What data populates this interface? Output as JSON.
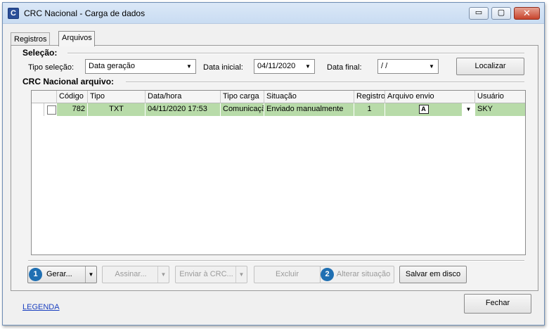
{
  "window": {
    "app_icon": "C",
    "title": "CRC Nacional - Carga de dados",
    "minimize": "▭",
    "maximize": "▢",
    "close": "✕"
  },
  "tabs": [
    {
      "label": "Registros"
    },
    {
      "label": "Arquivos"
    }
  ],
  "selection": {
    "title": "Seleção:",
    "tipo_label": "Tipo seleção:",
    "tipo_value": "Data geração",
    "data_inicial_label": "Data inicial:",
    "data_inicial_value": "04/11/2020",
    "data_final_label": "Data final:",
    "data_final_value": " /  /",
    "localizar": "Localizar"
  },
  "grid": {
    "title": "CRC Nacional arquivo:",
    "columns": [
      "Código",
      "Tipo",
      "Data/hora",
      "Tipo carga",
      "Situação",
      "Registro",
      "Arquivo envio",
      "Usuário"
    ],
    "rows": [
      {
        "codigo": "782",
        "tipo": "TXT",
        "data_hora": "04/11/2020 17:53",
        "tipo_carga": "Comunicação",
        "situacao": "Enviado manualmente",
        "registros": "1",
        "arquivo_icon": "A",
        "usuario": "SKY"
      }
    ]
  },
  "actions": {
    "badge1": "1",
    "gerar": "Gerar...",
    "assinar": "Assinar...",
    "enviar": "Enviar à CRC...",
    "excluir": "Excluir",
    "badge2": "2",
    "alterar": "Alterar situação",
    "salvar": "Salvar em disco"
  },
  "footer": {
    "legenda": "LEGENDA",
    "fechar": "Fechar"
  },
  "colors": {
    "selected_row": "#b8dba9",
    "badge": "#1f6fb2",
    "link": "#1a3fbf"
  }
}
